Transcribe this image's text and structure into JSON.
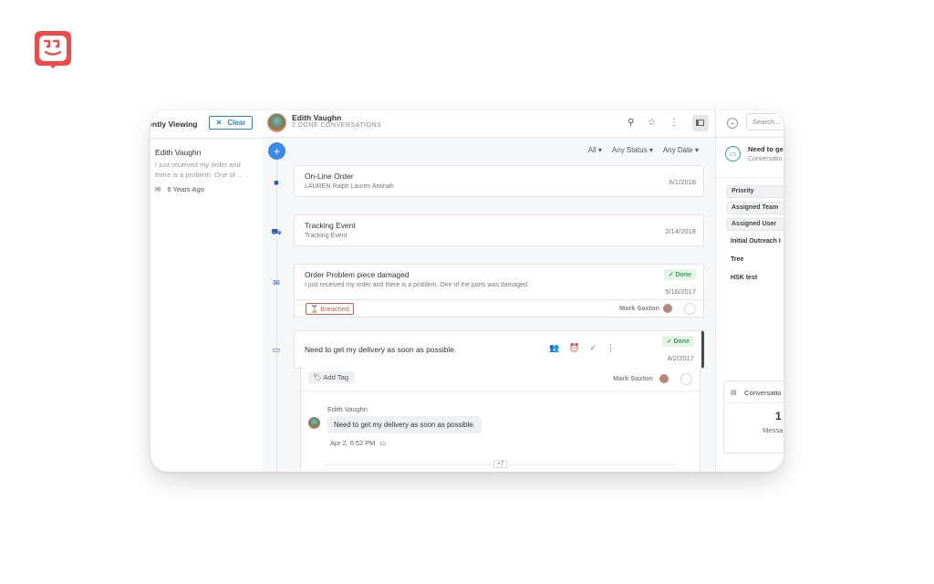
{
  "colors": {
    "brand": "#ef4b4b",
    "accent": "#3c8ae8",
    "success": "#3aa35a",
    "danger": "#e2574c"
  },
  "left_panel": {
    "title": "rently Viewing",
    "clear_label": "Clear",
    "conversation": {
      "name": "Edith Vaughn",
      "preview": "I just received my order and there is a problem. One of ...",
      "time": "6 Years Ago"
    }
  },
  "header": {
    "name": "Edith Vaughn",
    "subtitle": "2 DONE CONVERSATIONS",
    "icons": [
      "assign-user-icon",
      "star-icon",
      "more-vertical-icon",
      "panel-toggle-icon"
    ]
  },
  "filters": {
    "all": "All",
    "status": "Any Status",
    "date": "Any Date"
  },
  "timeline": [
    {
      "icon": "folder-icon",
      "title": "On-Line Order",
      "subtitle": "LAUREN Ralph Lauren Aminah",
      "date": "6/1/2018"
    },
    {
      "icon": "truck-icon",
      "title": "Tracking Event",
      "subtitle": "Tracking Event",
      "date": "2/14/2018"
    },
    {
      "icon": "email-icon",
      "title": "Order Problem piece damaged",
      "subtitle": "I just received my order and there is a problem. One of the parts was damaged.",
      "date": "5/16/2017",
      "status": "Done",
      "tag": "Breached",
      "assignee": "Mark Saxton"
    },
    {
      "icon": "chat-icon",
      "title": "Need to get my delivery as soon as possible.",
      "date": "4/2/2017",
      "status": "Done",
      "assignee": "Mark Saxton"
    }
  ],
  "thread": {
    "add_tag": "Add Tag",
    "author": "Edith Vaughn",
    "message": "Need to get my delivery as soon as possible.",
    "time": "Apr 2, 6:52 PM",
    "more_count": "+7"
  },
  "right_panel": {
    "search_placeholder": "Search...",
    "conversation_title": "Need to ge",
    "conversation_sub": "Conversatio",
    "fields": [
      "Priority",
      "Assigned Team",
      "Assigned User"
    ],
    "plain_fields": [
      "Initial Outreach I",
      "Tree",
      "HSK test"
    ],
    "stats_title": "Conversatio",
    "stats_value": "1",
    "stats_label": "Messa"
  }
}
